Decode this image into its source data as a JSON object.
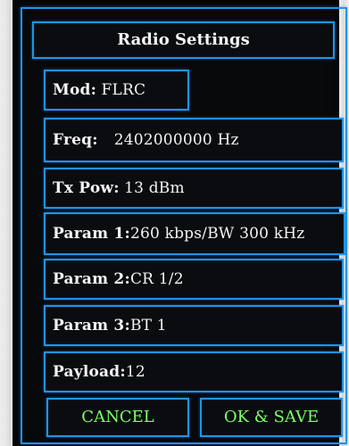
{
  "title": "Radio Settings",
  "fields": {
    "mod": {
      "label": "Mod:",
      "value": "FLRC"
    },
    "freq": {
      "label": "Freq:",
      "value": "2402000000 Hz"
    },
    "txpow": {
      "label": "Tx Pow:",
      "value": "13 dBm"
    },
    "param1": {
      "label": "Param 1:",
      "value": "260 kbps/BW 300 kHz"
    },
    "param2": {
      "label": "Param 2:",
      "value": "CR 1/2"
    },
    "param3": {
      "label": "Param 3:",
      "value": "BT 1"
    },
    "payload": {
      "label": "Payload:",
      "value": "12"
    }
  },
  "buttons": {
    "cancel": "CANCEL",
    "save": "OK & SAVE"
  },
  "colors": {
    "border": "#1f94e6",
    "button_text": "#7dff6a",
    "text": "#f4f4f4",
    "background": "#07090b"
  }
}
